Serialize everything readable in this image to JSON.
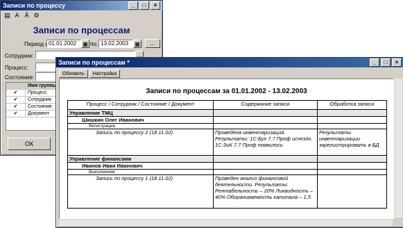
{
  "window1": {
    "title": "Записи по процессу",
    "heading": "Записи по процессам",
    "period_label": "Период с:",
    "date_from": "01.01.2002",
    "to_label": "по:",
    "date_to": "13.02.2003",
    "employee_label": "Сотрудник:",
    "process_label": "Процесс:",
    "state_label": "Состояние:",
    "grid_header": "Имя группы",
    "grid_rows": [
      "Процесс",
      "Сотрудник",
      "Состояние",
      "Документ"
    ],
    "ok_label": "ОК",
    "browse_label": "..."
  },
  "window2": {
    "title": "Записи по процессам *",
    "tab_refresh": "Обновить",
    "tab_settings": "Настройка",
    "report_title": "Записи по процессам за 01.01.2002 - 13.02.2003",
    "headers": [
      "Процесс / Сотрудник / Состояние / Документ",
      "Содержание записи",
      "Обработка записи"
    ],
    "rows": [
      {
        "c1": "Управление ТМЦ",
        "c2": "",
        "c3": "",
        "style": "grp"
      },
      {
        "c1": "Шишкин Олег Иванович",
        "c2": "",
        "c3": "",
        "style": "emp"
      },
      {
        "c1": "Регистрация",
        "c2": "",
        "c3": "",
        "style": "state"
      },
      {
        "c1": "Запись по процессу 2 (18.11.02)",
        "c2": "Проведена инвентаризация. Результаты: 1С:Бух 7.7 Проф исчезло. 1С:ЗиК 7.7 Проф появилось",
        "c3": "Результаты инвентаризации зарегистрировать в БД",
        "style": "doc"
      },
      {
        "c1": "Управление финансами",
        "c2": "",
        "c3": "",
        "style": "grp"
      },
      {
        "c1": "Иванов Иван Иванович",
        "c2": "",
        "c3": "",
        "style": "emp"
      },
      {
        "c1": "Выполнение",
        "c2": "",
        "c3": "",
        "style": "state"
      },
      {
        "c1": "Запись по процессу 1 (18.11.02)",
        "c2": "Проведен анализ финансовой деятельности. Результаты: Рентабельность – 20% Ликвидность – 40% Оборачиваемость капитала – 1,5",
        "c3": "",
        "style": "doc"
      }
    ]
  }
}
